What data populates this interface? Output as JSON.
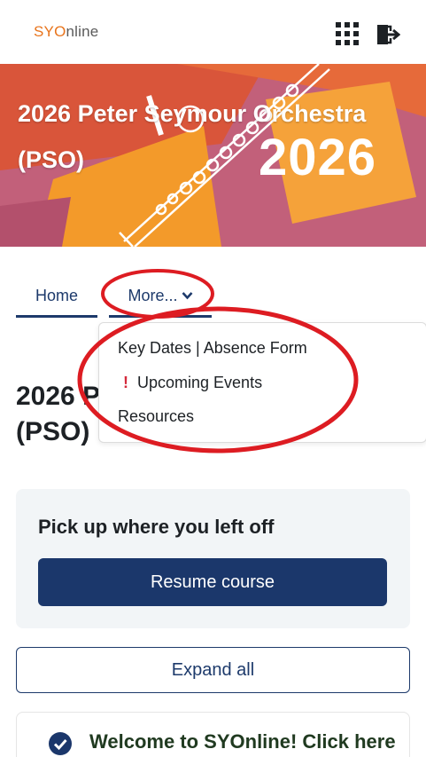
{
  "header": {
    "logo_prefix": "SYO",
    "logo_suffix": "nline",
    "icons": [
      "apps-grid-icon",
      "logout-icon"
    ]
  },
  "banner": {
    "title": "2026 Peter Seymour Orchestra (PSO)",
    "year": "2026",
    "colors": {
      "background": "#c2607a",
      "orange": "#f39a2a",
      "red": "#d9553a"
    }
  },
  "nav": {
    "tabs": [
      {
        "label": "Home"
      },
      {
        "label": "More...",
        "chevron": "▾"
      }
    ]
  },
  "page": {
    "heading": "2026 Peter Seymour Orchestra (PSO)"
  },
  "dropdown": {
    "items": [
      {
        "label": "Key Dates | Absence Form"
      },
      {
        "label": "Upcoming Events",
        "marker": "!"
      },
      {
        "label": "Resources"
      }
    ]
  },
  "resume_card": {
    "title": "Pick up where you left off",
    "button": "Resume course"
  },
  "expand": {
    "label": "Expand all"
  },
  "section": {
    "title": "Welcome to SYOnline! Click here"
  },
  "accent_colors": {
    "navy": "#1b376b",
    "annotation_red": "#dd1c22"
  }
}
